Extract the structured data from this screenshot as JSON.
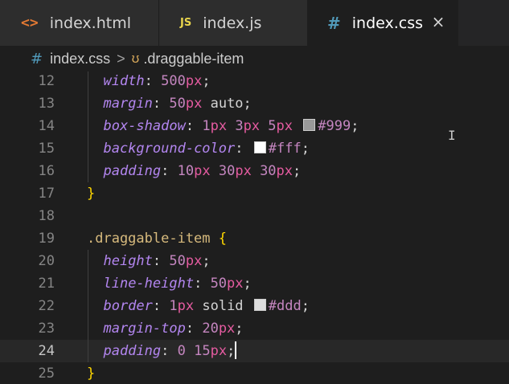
{
  "tabs": [
    {
      "label": "index.html",
      "icon": "html-icon",
      "icon_text": "<>",
      "active": false
    },
    {
      "label": "index.js",
      "icon": "js-icon",
      "icon_text": "JS",
      "active": false
    },
    {
      "label": "index.css",
      "icon": "css-icon",
      "icon_text": "#",
      "active": true
    }
  ],
  "close_label": "×",
  "breadcrumb": {
    "file": "index.css",
    "file_icon_text": "#",
    "separator": ">",
    "symbol_icon_text": "ʊ",
    "symbol": ".draggable-item"
  },
  "colors": {
    "property": "#b386f0",
    "number": "#c586c0",
    "unit": "#e45ba0",
    "selector": "#d7ba7d",
    "brace": "#ffd700",
    "line_number": "#858585",
    "active_line_number": "#c6c6c6",
    "editor_bg": "#1e1e1e",
    "swatch_999": "#999999",
    "swatch_fff": "#ffffff",
    "swatch_ddd": "#dddddd"
  },
  "lines": [
    {
      "n": "12",
      "prop": "width",
      "parts": [
        [
          "500",
          "num"
        ],
        [
          "px",
          "unit"
        ],
        [
          ";",
          "p"
        ]
      ]
    },
    {
      "n": "13",
      "prop": "margin",
      "parts": [
        [
          "50",
          "num"
        ],
        [
          "px",
          "unit"
        ],
        [
          " auto",
          "v"
        ],
        [
          ";",
          "p"
        ]
      ]
    },
    {
      "n": "14",
      "prop": "box-shadow",
      "parts": [
        [
          "1",
          "num"
        ],
        [
          "px",
          "unit"
        ],
        [
          " ",
          "p"
        ],
        [
          "3",
          "num"
        ],
        [
          "px",
          "unit"
        ],
        [
          " ",
          "p"
        ],
        [
          "5",
          "num"
        ],
        [
          "px",
          "unit"
        ],
        [
          " ",
          "p"
        ],
        [
          "#999",
          "sw"
        ],
        [
          ";",
          "p"
        ]
      ]
    },
    {
      "n": "15",
      "prop": "background-color",
      "parts": [
        [
          "#fff",
          "sw"
        ],
        [
          ";",
          "p"
        ]
      ]
    },
    {
      "n": "16",
      "prop": "padding",
      "parts": [
        [
          "10",
          "num"
        ],
        [
          "px",
          "unit"
        ],
        [
          " ",
          "p"
        ],
        [
          "30",
          "num"
        ],
        [
          "px",
          "unit"
        ],
        [
          " ",
          "p"
        ],
        [
          "30",
          "num"
        ],
        [
          "px",
          "unit"
        ],
        [
          ";",
          "p"
        ]
      ]
    },
    {
      "n": "17",
      "text": "}",
      "kind": "brace"
    },
    {
      "n": "18",
      "text": "",
      "kind": "blank"
    },
    {
      "n": "19",
      "text": ".draggable-item",
      "kind": "selector",
      "brace": "{"
    },
    {
      "n": "20",
      "prop": "height",
      "parts": [
        [
          "50",
          "num"
        ],
        [
          "px",
          "unit"
        ],
        [
          ";",
          "p"
        ]
      ]
    },
    {
      "n": "21",
      "prop": "line-height",
      "parts": [
        [
          "50",
          "num"
        ],
        [
          "px",
          "unit"
        ],
        [
          ";",
          "p"
        ]
      ]
    },
    {
      "n": "22",
      "prop": "border",
      "parts": [
        [
          "1",
          "num"
        ],
        [
          "px",
          "unit"
        ],
        [
          " solid ",
          "v"
        ],
        [
          "#ddd",
          "sw"
        ],
        [
          ";",
          "p"
        ]
      ]
    },
    {
      "n": "23",
      "prop": "margin-top",
      "parts": [
        [
          "20",
          "num"
        ],
        [
          "px",
          "unit"
        ],
        [
          ";",
          "p"
        ]
      ]
    },
    {
      "n": "24",
      "prop": "padding",
      "parts": [
        [
          "0",
          "num"
        ],
        [
          " ",
          "p"
        ],
        [
          "15",
          "num"
        ],
        [
          "px",
          "unit"
        ],
        [
          ";",
          "p"
        ]
      ],
      "active": true
    },
    {
      "n": "25",
      "text": "}",
      "kind": "brace"
    }
  ],
  "ibeam": "I"
}
